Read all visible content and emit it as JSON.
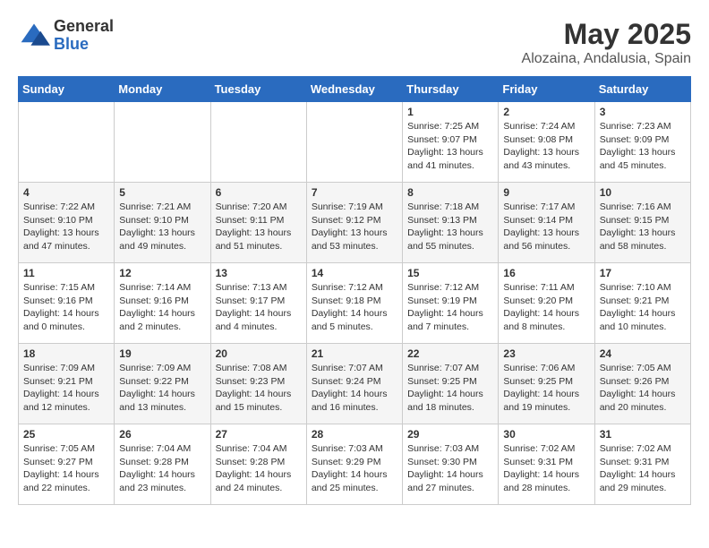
{
  "header": {
    "logo_general": "General",
    "logo_blue": "Blue",
    "month_year": "May 2025",
    "location": "Alozaina, Andalusia, Spain"
  },
  "days_of_week": [
    "Sunday",
    "Monday",
    "Tuesday",
    "Wednesday",
    "Thursday",
    "Friday",
    "Saturday"
  ],
  "weeks": [
    [
      {
        "day": "",
        "info": ""
      },
      {
        "day": "",
        "info": ""
      },
      {
        "day": "",
        "info": ""
      },
      {
        "day": "",
        "info": ""
      },
      {
        "day": "1",
        "info": "Sunrise: 7:25 AM\nSunset: 9:07 PM\nDaylight: 13 hours\nand 41 minutes."
      },
      {
        "day": "2",
        "info": "Sunrise: 7:24 AM\nSunset: 9:08 PM\nDaylight: 13 hours\nand 43 minutes."
      },
      {
        "day": "3",
        "info": "Sunrise: 7:23 AM\nSunset: 9:09 PM\nDaylight: 13 hours\nand 45 minutes."
      }
    ],
    [
      {
        "day": "4",
        "info": "Sunrise: 7:22 AM\nSunset: 9:10 PM\nDaylight: 13 hours\nand 47 minutes."
      },
      {
        "day": "5",
        "info": "Sunrise: 7:21 AM\nSunset: 9:10 PM\nDaylight: 13 hours\nand 49 minutes."
      },
      {
        "day": "6",
        "info": "Sunrise: 7:20 AM\nSunset: 9:11 PM\nDaylight: 13 hours\nand 51 minutes."
      },
      {
        "day": "7",
        "info": "Sunrise: 7:19 AM\nSunset: 9:12 PM\nDaylight: 13 hours\nand 53 minutes."
      },
      {
        "day": "8",
        "info": "Sunrise: 7:18 AM\nSunset: 9:13 PM\nDaylight: 13 hours\nand 55 minutes."
      },
      {
        "day": "9",
        "info": "Sunrise: 7:17 AM\nSunset: 9:14 PM\nDaylight: 13 hours\nand 56 minutes."
      },
      {
        "day": "10",
        "info": "Sunrise: 7:16 AM\nSunset: 9:15 PM\nDaylight: 13 hours\nand 58 minutes."
      }
    ],
    [
      {
        "day": "11",
        "info": "Sunrise: 7:15 AM\nSunset: 9:16 PM\nDaylight: 14 hours\nand 0 minutes."
      },
      {
        "day": "12",
        "info": "Sunrise: 7:14 AM\nSunset: 9:16 PM\nDaylight: 14 hours\nand 2 minutes."
      },
      {
        "day": "13",
        "info": "Sunrise: 7:13 AM\nSunset: 9:17 PM\nDaylight: 14 hours\nand 4 minutes."
      },
      {
        "day": "14",
        "info": "Sunrise: 7:12 AM\nSunset: 9:18 PM\nDaylight: 14 hours\nand 5 minutes."
      },
      {
        "day": "15",
        "info": "Sunrise: 7:12 AM\nSunset: 9:19 PM\nDaylight: 14 hours\nand 7 minutes."
      },
      {
        "day": "16",
        "info": "Sunrise: 7:11 AM\nSunset: 9:20 PM\nDaylight: 14 hours\nand 8 minutes."
      },
      {
        "day": "17",
        "info": "Sunrise: 7:10 AM\nSunset: 9:21 PM\nDaylight: 14 hours\nand 10 minutes."
      }
    ],
    [
      {
        "day": "18",
        "info": "Sunrise: 7:09 AM\nSunset: 9:21 PM\nDaylight: 14 hours\nand 12 minutes."
      },
      {
        "day": "19",
        "info": "Sunrise: 7:09 AM\nSunset: 9:22 PM\nDaylight: 14 hours\nand 13 minutes."
      },
      {
        "day": "20",
        "info": "Sunrise: 7:08 AM\nSunset: 9:23 PM\nDaylight: 14 hours\nand 15 minutes."
      },
      {
        "day": "21",
        "info": "Sunrise: 7:07 AM\nSunset: 9:24 PM\nDaylight: 14 hours\nand 16 minutes."
      },
      {
        "day": "22",
        "info": "Sunrise: 7:07 AM\nSunset: 9:25 PM\nDaylight: 14 hours\nand 18 minutes."
      },
      {
        "day": "23",
        "info": "Sunrise: 7:06 AM\nSunset: 9:25 PM\nDaylight: 14 hours\nand 19 minutes."
      },
      {
        "day": "24",
        "info": "Sunrise: 7:05 AM\nSunset: 9:26 PM\nDaylight: 14 hours\nand 20 minutes."
      }
    ],
    [
      {
        "day": "25",
        "info": "Sunrise: 7:05 AM\nSunset: 9:27 PM\nDaylight: 14 hours\nand 22 minutes."
      },
      {
        "day": "26",
        "info": "Sunrise: 7:04 AM\nSunset: 9:28 PM\nDaylight: 14 hours\nand 23 minutes."
      },
      {
        "day": "27",
        "info": "Sunrise: 7:04 AM\nSunset: 9:28 PM\nDaylight: 14 hours\nand 24 minutes."
      },
      {
        "day": "28",
        "info": "Sunrise: 7:03 AM\nSunset: 9:29 PM\nDaylight: 14 hours\nand 25 minutes."
      },
      {
        "day": "29",
        "info": "Sunrise: 7:03 AM\nSunset: 9:30 PM\nDaylight: 14 hours\nand 27 minutes."
      },
      {
        "day": "30",
        "info": "Sunrise: 7:02 AM\nSunset: 9:31 PM\nDaylight: 14 hours\nand 28 minutes."
      },
      {
        "day": "31",
        "info": "Sunrise: 7:02 AM\nSunset: 9:31 PM\nDaylight: 14 hours\nand 29 minutes."
      }
    ]
  ]
}
